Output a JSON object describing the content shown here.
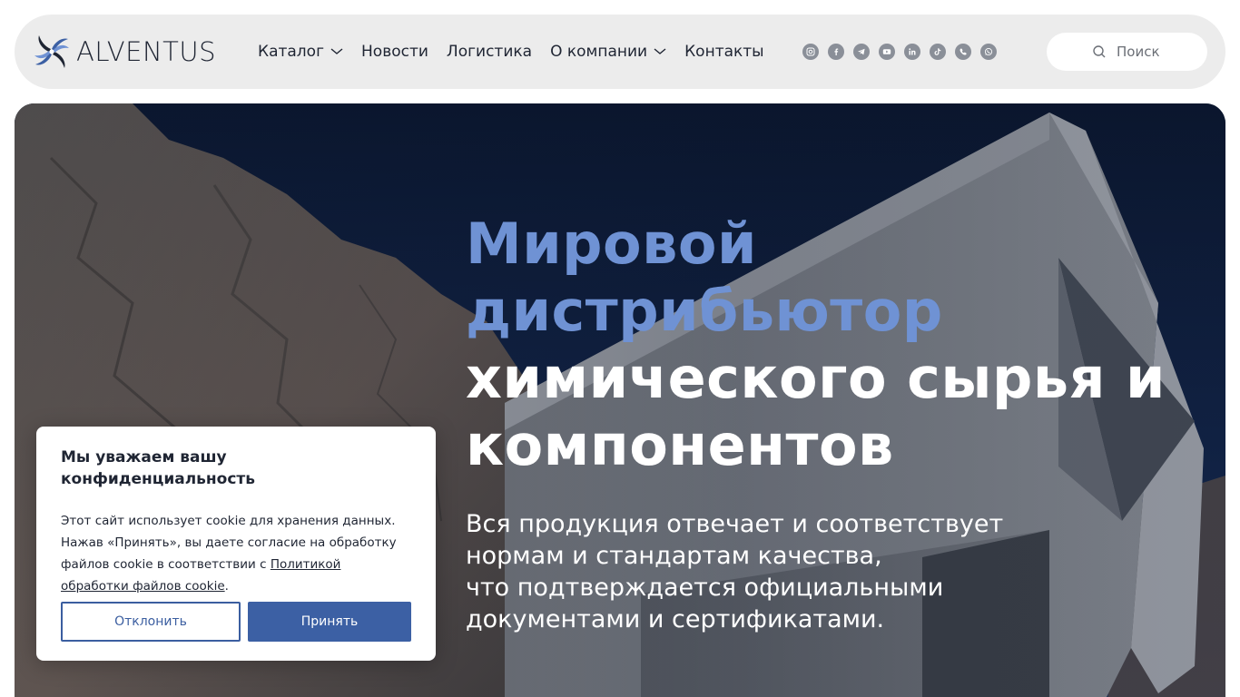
{
  "brand": {
    "name": "ALVENTUS",
    "color": "#3c60a4"
  },
  "nav": {
    "items": [
      {
        "label": "Каталог",
        "has_dropdown": true
      },
      {
        "label": "Новости",
        "has_dropdown": false
      },
      {
        "label": "Логистика",
        "has_dropdown": false
      },
      {
        "label": "О компании",
        "has_dropdown": true
      },
      {
        "label": "Контакты",
        "has_dropdown": false
      }
    ]
  },
  "socials": [
    "instagram-icon",
    "facebook-icon",
    "telegram-icon",
    "youtube-icon",
    "linkedin-icon",
    "tiktok-icon",
    "viber-icon",
    "whatsapp-icon"
  ],
  "search": {
    "placeholder": "Поиск"
  },
  "hero": {
    "title_accent_1": "Мировой",
    "title_accent_2": "дистрибьютор",
    "title_white_1": "химического сырья и",
    "title_white_2": "компонентов",
    "subtitle_lines": [
      "Вся продукция отвечает и соответствует",
      "нормам и стандартам качества,",
      "что подтверждается официальными",
      "документами и сертификатами."
    ],
    "accent_color": "#6f92d4"
  },
  "cookie": {
    "title": "Мы уважаем вашу конфиденциальность",
    "text_before_link": "Этот сайт использует cookie для хранения данных. Нажав «Принять», вы даете согласие на обработку файлов cookie в соответствии с ",
    "link_text": "Политикой обработки файлов cookie",
    "text_after_link": ".",
    "decline_label": "Отклонить",
    "accept_label": "Принять"
  }
}
